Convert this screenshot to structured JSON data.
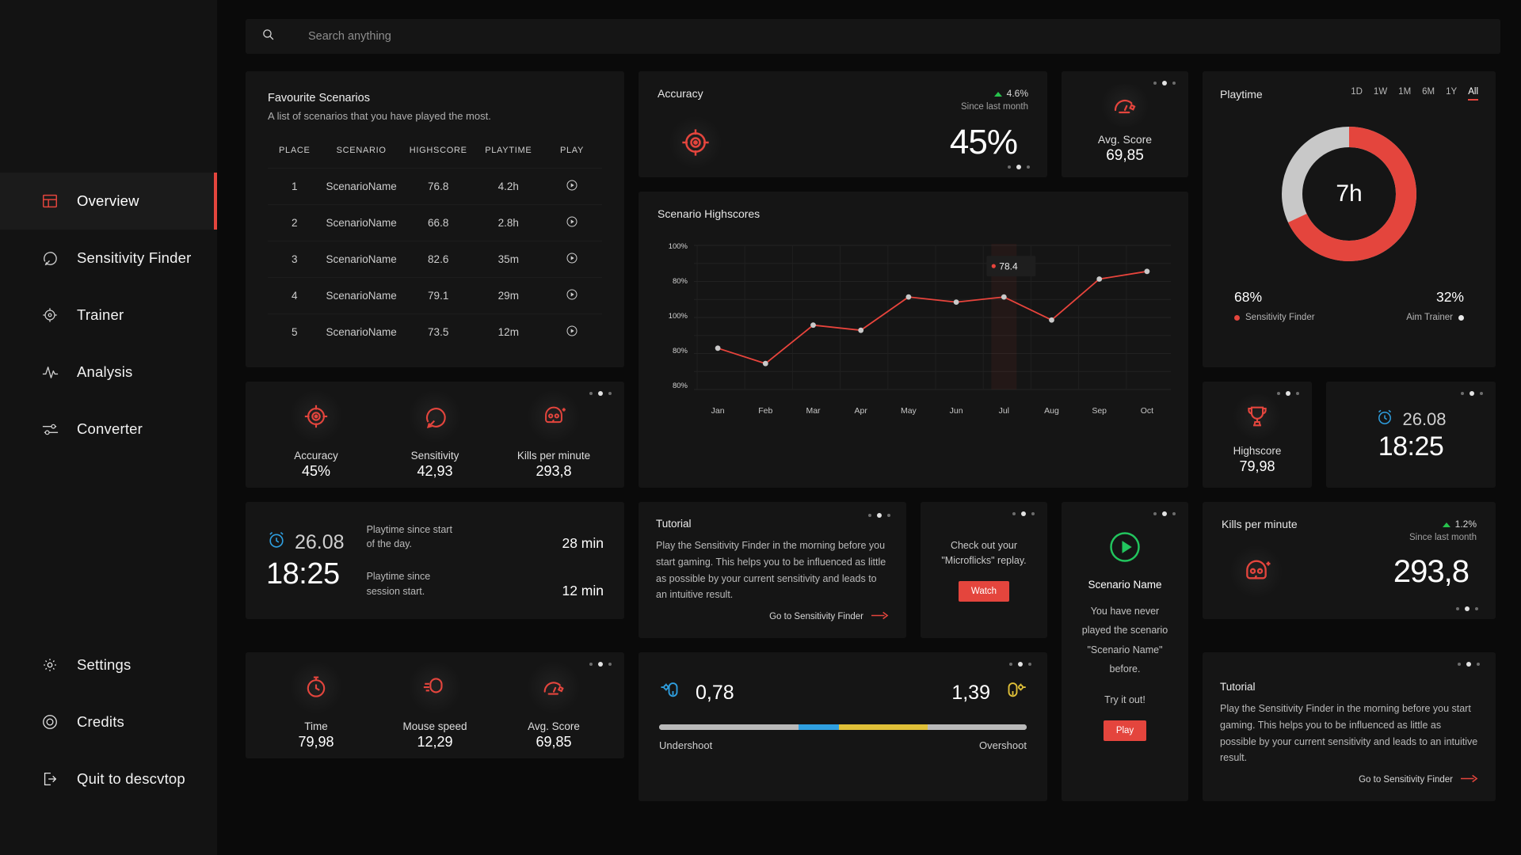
{
  "sidebar": {
    "items": [
      {
        "label": "Overview",
        "icon": "layout-icon",
        "active": true
      },
      {
        "label": "Sensitivity Finder",
        "icon": "sensitivity-icon",
        "active": false
      },
      {
        "label": "Trainer",
        "icon": "crosshair-icon",
        "active": false
      },
      {
        "label": "Analysis",
        "icon": "pulse-icon",
        "active": false
      },
      {
        "label": "Converter",
        "icon": "sliders-icon",
        "active": false
      }
    ],
    "bottom_items": [
      {
        "label": "Settings",
        "icon": "gear-icon"
      },
      {
        "label": "Credits",
        "icon": "circle-icon"
      },
      {
        "label": "Quit to descvtop",
        "icon": "logout-icon"
      }
    ]
  },
  "search": {
    "placeholder": "Search anything",
    "value": "",
    "icon": "search-icon"
  },
  "favourites": {
    "title": "Favourite Scenarios",
    "subtitle": "A list of scenarios that you have played the most.",
    "columns": [
      "PLACE",
      "SCENARIO",
      "HIGHSCORE",
      "PLAYTIME",
      "PLAY"
    ],
    "rows": [
      {
        "place": "1",
        "scenario": "ScenarioName",
        "highscore": "76.8",
        "playtime": "4.2h"
      },
      {
        "place": "2",
        "scenario": "ScenarioName",
        "highscore": "66.8",
        "playtime": "2.8h"
      },
      {
        "place": "3",
        "scenario": "ScenarioName",
        "highscore": "82.6",
        "playtime": "35m"
      },
      {
        "place": "4",
        "scenario": "ScenarioName",
        "highscore": "79.1",
        "playtime": "29m"
      },
      {
        "place": "5",
        "scenario": "ScenarioName",
        "highscore": "73.5",
        "playtime": "12m"
      }
    ]
  },
  "accuracy_card": {
    "title": "Accuracy",
    "value": "45%",
    "trend_pct": "4.6%",
    "trend_label": "Since last month",
    "trend_color": "#27c24c",
    "icon": "target-icon"
  },
  "avg_score_card": {
    "label": "Avg. Score",
    "value": "69,85",
    "icon": "gauge-icon"
  },
  "playtime_card": {
    "title": "Playtime",
    "ranges": [
      "1D",
      "1W",
      "1M",
      "6M",
      "1Y",
      "All"
    ],
    "active_range": "All",
    "center_value": "7h",
    "segments": [
      {
        "label": "Sensitivity Finder",
        "value": "68%",
        "color": "#e4453d"
      },
      {
        "label": "Aim Trainer",
        "value": "32%",
        "color": "#c8c8c8"
      }
    ]
  },
  "highscores_chart": {
    "title": "Scenario Highscores"
  },
  "chart_data": {
    "type": "line",
    "title": "Scenario Highscores",
    "xlabel": "",
    "ylabel": "",
    "categories": [
      "Jan",
      "Feb",
      "Mar",
      "Apr",
      "May",
      "Jun",
      "Jul",
      "Aug",
      "Sep",
      "Oct"
    ],
    "ytick_labels": [
      "100%",
      "80%",
      "100%",
      "80%",
      "80%"
    ],
    "values": [
      63.0,
      57.0,
      72.0,
      70.0,
      83.0,
      81.0,
      83.0,
      74.0,
      90.0,
      93.0
    ],
    "ylim": [
      45,
      105
    ],
    "grid": true,
    "line_color": "#e8443c",
    "point_color": "#c9c9c9",
    "tooltip": {
      "label": "78.4",
      "category": "Jul",
      "color": "#e8443c"
    },
    "legend": "none"
  },
  "stat_cards": [
    {
      "label": "Accuracy",
      "value": "45%",
      "icon": "target-icon"
    },
    {
      "label": "Sensitivity",
      "value": "42,93",
      "icon": "sensitivity-icon"
    },
    {
      "label": "Kills per minute",
      "value": "293,8",
      "icon": "skull-icon"
    },
    {
      "label": "Time",
      "value": "79,98",
      "icon": "stopwatch-icon"
    },
    {
      "label": "Mouse speed",
      "value": "12,29",
      "icon": "mouse-speed-icon"
    },
    {
      "label": "Avg. Score",
      "value": "69,85",
      "icon": "gauge-icon"
    }
  ],
  "highscore_card": {
    "label": "Highscore",
    "value": "79,98",
    "icon": "trophy-icon"
  },
  "clock_card_right": {
    "date": "26.08",
    "time": "18:25",
    "icon": "alarm-icon",
    "color": "#2f9fe0"
  },
  "clock_card": {
    "date": "26.08",
    "time": "18:25",
    "icon": "alarm-icon",
    "color": "#2f9fe0",
    "rows": [
      {
        "text": "Playtime since start of the day.",
        "value": "28 min"
      },
      {
        "text": "Playtime since session start.",
        "value": "12 min"
      }
    ]
  },
  "tutorial_card": {
    "title": "Tutorial",
    "body": "Play the Sensitivity Finder in the morning before you start gaming. This helps you to be influenced as little as possible by your current sensitivity and leads to an intuitive result.",
    "link": "Go to Sensitivity Finder"
  },
  "tutorial_card_right": {
    "title": "Tutorial",
    "body": "Play the Sensitivity Finder in the morning before you start gaming. This helps you to be influenced as little as possible by your current sensitivity and leads to an intuitive result.",
    "link": "Go to Sensitivity Finder"
  },
  "microflicks_card": {
    "text": "Check out your \"Microflicks\" replay.",
    "button": "Watch"
  },
  "scenario_card": {
    "name": "Scenario Name",
    "body": "You have never played the scenario \"Scenario Name\" before.",
    "cta_text": "Try it out!",
    "button": "Play",
    "icon": "play-circle-icon",
    "color": "#22c55e"
  },
  "kpm_card": {
    "title": "Kills per minute",
    "value": "293,8",
    "trend_pct": "1.2%",
    "trend_label": "Since last month",
    "icon": "skull-icon"
  },
  "shoot_card": {
    "under_value": "0,78",
    "over_value": "1,39",
    "under_label": "Undershoot",
    "over_label": "Overshoot",
    "under_color": "#2f9fe0",
    "over_color": "#e0c038",
    "track_color": "#b9b9b9"
  }
}
